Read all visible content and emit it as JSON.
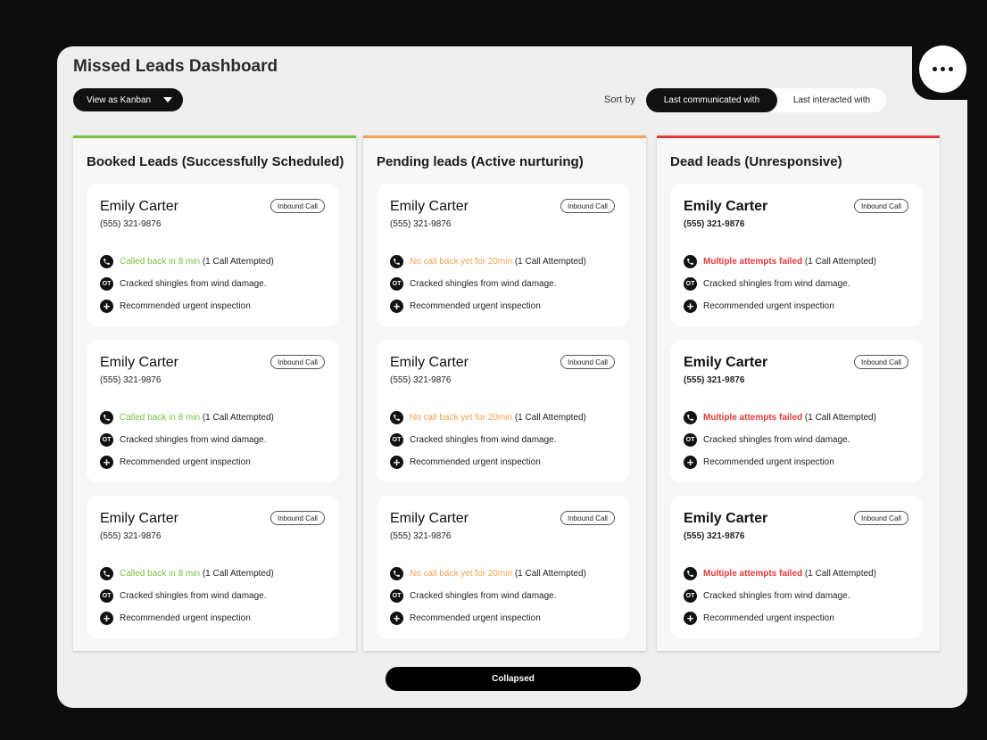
{
  "header": {
    "title": "Missed Leads Dashboard",
    "view_button": "View as Kanban",
    "sort_label": "Sort by",
    "sort_options": [
      "Last communicated with",
      "Last interacted with"
    ],
    "sort_selected": "Last communicated with"
  },
  "colors": {
    "booked": "#7ac142",
    "pending": "#f5a350",
    "dead": "#e23b3b"
  },
  "columns": [
    {
      "title": "Booked Leads (Successfully Scheduled)",
      "cards": [
        {
          "name": "Emily Carter",
          "phone": "(555) 321-9876",
          "tag": "Inbound Call",
          "status": "Called back in 8 min",
          "attempt": "(1 Call Attempted)",
          "note": "Cracked shingles from wind damage.",
          "action": "Recommended urgent inspection",
          "ot": "OT"
        },
        {
          "name": "Emily Carter",
          "phone": "(555) 321-9876",
          "tag": "Inbound Call",
          "status": "Called back in 8 min",
          "attempt": "(1 Call Attempted)",
          "note": "Cracked shingles from wind damage.",
          "action": "Recommended urgent inspection",
          "ot": "OT"
        },
        {
          "name": "Emily Carter",
          "phone": "(555) 321-9876",
          "tag": "Inbound Call",
          "status": "Called back in 8 min",
          "attempt": "(1 Call Attempted)",
          "note": "Cracked shingles from wind damage.",
          "action": "Recommended urgent inspection",
          "ot": "OT"
        }
      ]
    },
    {
      "title": "Pending leads (Active nurturing)",
      "cards": [
        {
          "name": "Emily Carter",
          "phone": "(555) 321-9876",
          "tag": "Inbound Call",
          "status": "No call back yet for 20min",
          "attempt": "(1 Call Attempted)",
          "note": "Cracked shingles from wind damage.",
          "action": "Recommended urgent inspection",
          "ot": "OT"
        },
        {
          "name": "Emily Carter",
          "phone": "(555) 321-9876",
          "tag": "Inbound Call",
          "status": "No call back yet for 20min",
          "attempt": "(1 Call Attempted)",
          "note": "Cracked shingles from wind damage.",
          "action": "Recommended urgent inspection",
          "ot": "OT"
        },
        {
          "name": "Emily Carter",
          "phone": "(555) 321-9876",
          "tag": "Inbound Call",
          "status": "No call back yet for 20min",
          "attempt": "(1 Call Attempted)",
          "note": "Cracked shingles from wind damage.",
          "action": "Recommended urgent inspection",
          "ot": "OT"
        }
      ]
    },
    {
      "title": "Dead leads (Unresponsive)",
      "cards": [
        {
          "name": "Emily Carter",
          "phone": "(555) 321-9876",
          "tag": "Inbound Call",
          "status": "Multiple attempts failed",
          "attempt": "(1 Call Attempted)",
          "note": "Cracked shingles from wind damage.",
          "action": "Recommended urgent inspection",
          "ot": "OT"
        },
        {
          "name": "Emily Carter",
          "phone": "(555) 321-9876",
          "tag": "Inbound Call",
          "status": "Multiple attempts failed",
          "attempt": "(1 Call Attempted)",
          "note": "Cracked shingles from wind damage.",
          "action": "Recommended urgent inspection",
          "ot": "OT"
        },
        {
          "name": "Emily Carter",
          "phone": "(555) 321-9876",
          "tag": "Inbound Call",
          "status": "Multiple attempts failed",
          "attempt": "(1 Call Attempted)",
          "note": "Cracked shingles from wind damage.",
          "action": "Recommended urgent inspection",
          "ot": "OT"
        }
      ]
    }
  ],
  "footer": {
    "collapse_button": "Collapsed"
  }
}
